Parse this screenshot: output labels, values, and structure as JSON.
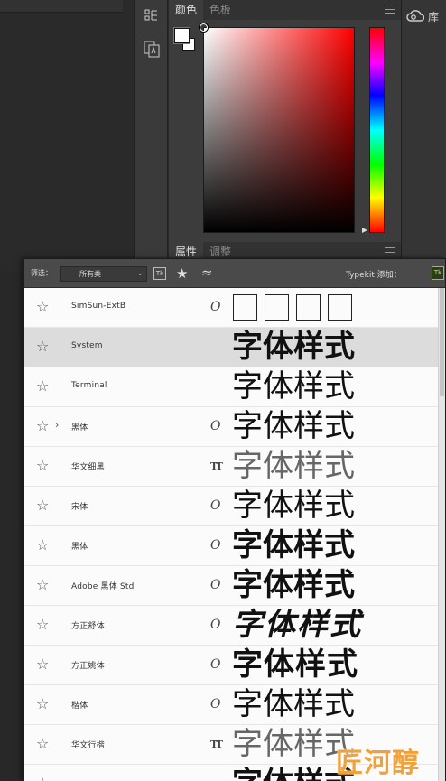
{
  "color_panel": {
    "tabs": [
      {
        "label": "颜色",
        "active": true
      },
      {
        "label": "色板",
        "active": false
      }
    ],
    "foreground": "#ffffff",
    "background": "#ffffff",
    "hue_color": "#ff0000"
  },
  "libraries": {
    "label": "库"
  },
  "properties_panel": {
    "tabs": [
      {
        "label": "属性",
        "active": true
      },
      {
        "label": "调整",
        "active": false
      }
    ]
  },
  "font_list": {
    "filter_label": "筛选：",
    "filter_value": "所有类",
    "typekit_label": "Typekit 添加：",
    "typekit_icon": "Tk",
    "tk_filter_icon": "Tk",
    "fonts": [
      {
        "name": "SimSun-ExtB",
        "type_icon": "O",
        "sample": "",
        "sample_style": "boxes"
      },
      {
        "name": "System",
        "type_icon": "",
        "sample": "字体样式",
        "sample_style": "bold",
        "selected": true
      },
      {
        "name": "Terminal",
        "type_icon": "",
        "sample": "字体样式",
        "sample_style": "normal"
      },
      {
        "name": "黑体",
        "type_icon": "O",
        "sample": "字体样式",
        "sample_style": "normal",
        "expandable": true
      },
      {
        "name": "华文细黑",
        "type_icon": "TT",
        "sample": "字体样式",
        "sample_style": "light"
      },
      {
        "name": "宋体",
        "type_icon": "O",
        "sample": "字体样式",
        "sample_style": "song"
      },
      {
        "name": "黑体",
        "type_icon": "O",
        "sample": "字体样式",
        "sample_style": "bold"
      },
      {
        "name": "Adobe 黑体 Std",
        "type_icon": "O",
        "sample": "字体样式",
        "sample_style": "bold"
      },
      {
        "name": "方正舒体",
        "type_icon": "O",
        "sample": "字体样式",
        "sample_style": "brush"
      },
      {
        "name": "方正姚体",
        "type_icon": "O",
        "sample": "字体样式",
        "sample_style": "heavy"
      },
      {
        "name": "楷体",
        "type_icon": "O",
        "sample": "字体样式",
        "sample_style": "song"
      },
      {
        "name": "华文行楷",
        "type_icon": "TT",
        "sample": "字体样式",
        "sample_style": "light"
      },
      {
        "name": "",
        "type_icon": "",
        "sample": "字体样式",
        "sample_style": "bold"
      }
    ]
  },
  "watermark": {
    "text": "匠河醇坊"
  }
}
